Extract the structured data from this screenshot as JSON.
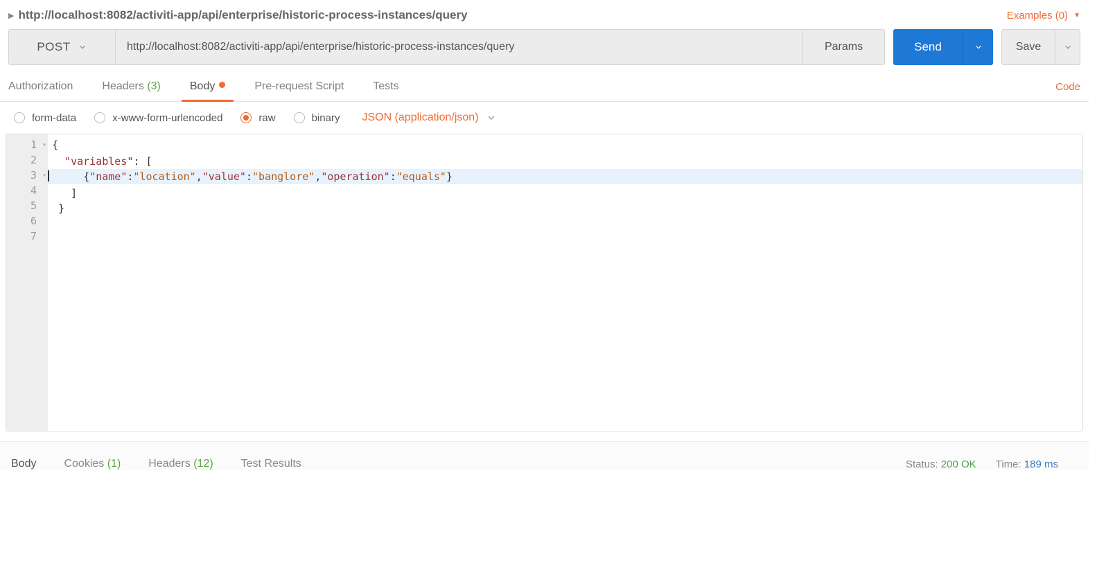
{
  "title": "http://localhost:8082/activiti-app/api/enterprise/historic-process-instances/query",
  "examples": "Examples (0)",
  "method": "POST",
  "url": "http://localhost:8082/activiti-app/api/enterprise/historic-process-instances/query",
  "buttons": {
    "params": "Params",
    "send": "Send",
    "save": "Save"
  },
  "tabs": {
    "authorization": "Authorization",
    "headers": "Headers ",
    "headers_count": "(3)",
    "body": "Body",
    "prerequest": "Pre-request Script",
    "tests": "Tests",
    "code": "Code"
  },
  "body_types": {
    "form_data": "form-data",
    "urlencoded": "x-www-form-urlencoded",
    "raw": "raw",
    "binary": "binary",
    "content_type": "JSON (application/json)"
  },
  "editor": {
    "lines": [
      "1",
      "2",
      "3",
      "4",
      "5",
      "6",
      "7"
    ],
    "l1": "{",
    "l2": "",
    "l3_indent": "  ",
    "l3_key": "\"variables\"",
    "l3_after": ": [",
    "l4_indent": "     {",
    "l4_k1": "\"name\"",
    "l4_v1": "\"location\"",
    "l4_k2": "\"value\"",
    "l4_v2": "\"banglore\"",
    "l4_k3": "\"operation\"",
    "l4_v3": "\"equals\"",
    "l4_close": "}",
    "l5": "",
    "l6": "   ]",
    "l7": " }"
  },
  "response": {
    "body": "Body",
    "cookies": "Cookies ",
    "cookies_count": "(1)",
    "headers": "Headers ",
    "headers_count": "(12)",
    "tests": "Test Results",
    "status_label": "Status: ",
    "status_value": "200 OK",
    "time_label": "Time: ",
    "time_value": "189 ms"
  }
}
